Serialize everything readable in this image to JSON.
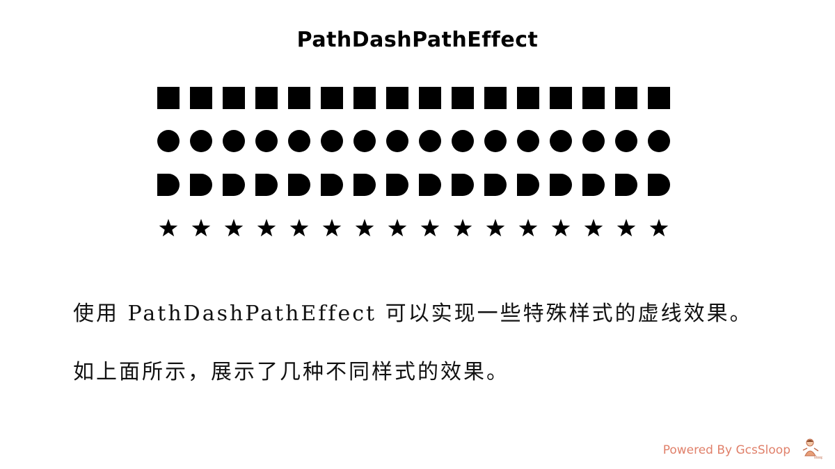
{
  "slide": {
    "title": "PathDashPathEffect",
    "shape_rows": [
      {
        "shape": "square",
        "count": 16
      },
      {
        "shape": "circle",
        "count": 16
      },
      {
        "shape": "d-shape",
        "count": 16
      },
      {
        "shape": "star",
        "count": 16
      }
    ],
    "shape_color": "#000000",
    "lines": [
      "使用 PathDashPathEffect 可以实现一些特殊样式的虚线效果。",
      "如上面所示，展示了几种不同样式的效果。"
    ],
    "brand": "Powered By GcsSloop",
    "brand_color": "#e0806a"
  }
}
